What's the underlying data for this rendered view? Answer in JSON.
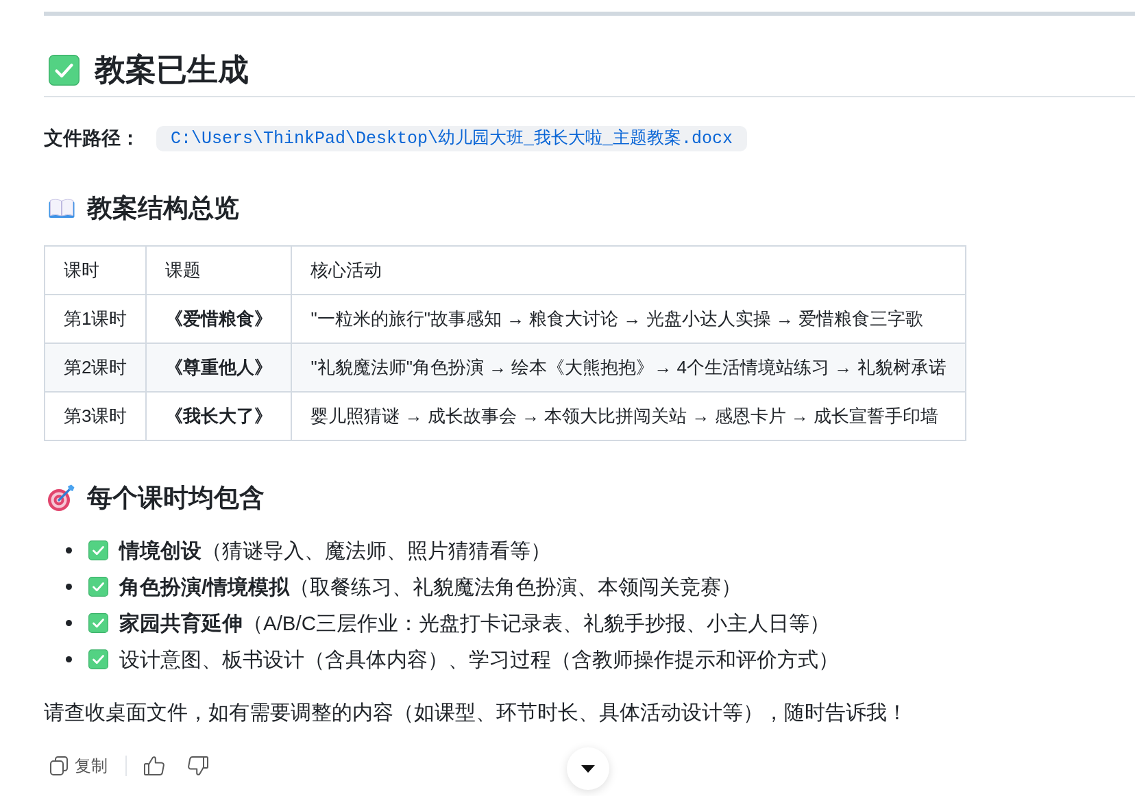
{
  "heading": {
    "title": "教案已生成"
  },
  "file_path": {
    "label": "文件路径：",
    "path": "C:\\Users\\ThinkPad\\Desktop\\幼儿园大班_我长大啦_主题教案.docx"
  },
  "overview": {
    "title": "教案结构总览",
    "table": {
      "columns": [
        "课时",
        "课题",
        "核心活动"
      ],
      "rows": [
        {
          "cells": [
            "第1课时",
            "《爱惜粮食》",
            "\"一粒米的旅行\"故事感知 → 粮食大讨论 → 光盘小达人实操 → 爱惜粮食三字歌"
          ]
        },
        {
          "cells": [
            "第2课时",
            "《尊重他人》",
            "\"礼貌魔法师\"角色扮演 → 绘本《大熊抱抱》→ 4个生活情境站练习 → 礼貌树承诺"
          ]
        },
        {
          "cells": [
            "第3课时",
            "《我长大了》",
            "婴儿照猜谜 → 成长故事会 → 本领大比拼闯关站 → 感恩卡片 → 成长宣誓手印墙"
          ]
        }
      ]
    }
  },
  "includes": {
    "title": "每个课时均包含",
    "items": [
      {
        "text": "**情境创设**（猜谜导入、魔法师、照片猜猜看等）"
      },
      {
        "text": "**角色扮演/情境模拟**（取餐练习、礼貌魔法角色扮演、本领闯关竞赛）"
      },
      {
        "text": "**家园共育延伸**（A/B/C三层作业：光盘打卡记录表、礼貌手抄报、小主人日等）"
      },
      {
        "text": "设计意图、板书设计（含具体内容）、学习过程（含教师操作提示和评价方式）"
      }
    ]
  },
  "closing": "请查收桌面文件，如有需要调整的内容（如课型、环节时长、具体活动设计等），随时告诉我！",
  "actions": {
    "copy_label": "复制"
  }
}
